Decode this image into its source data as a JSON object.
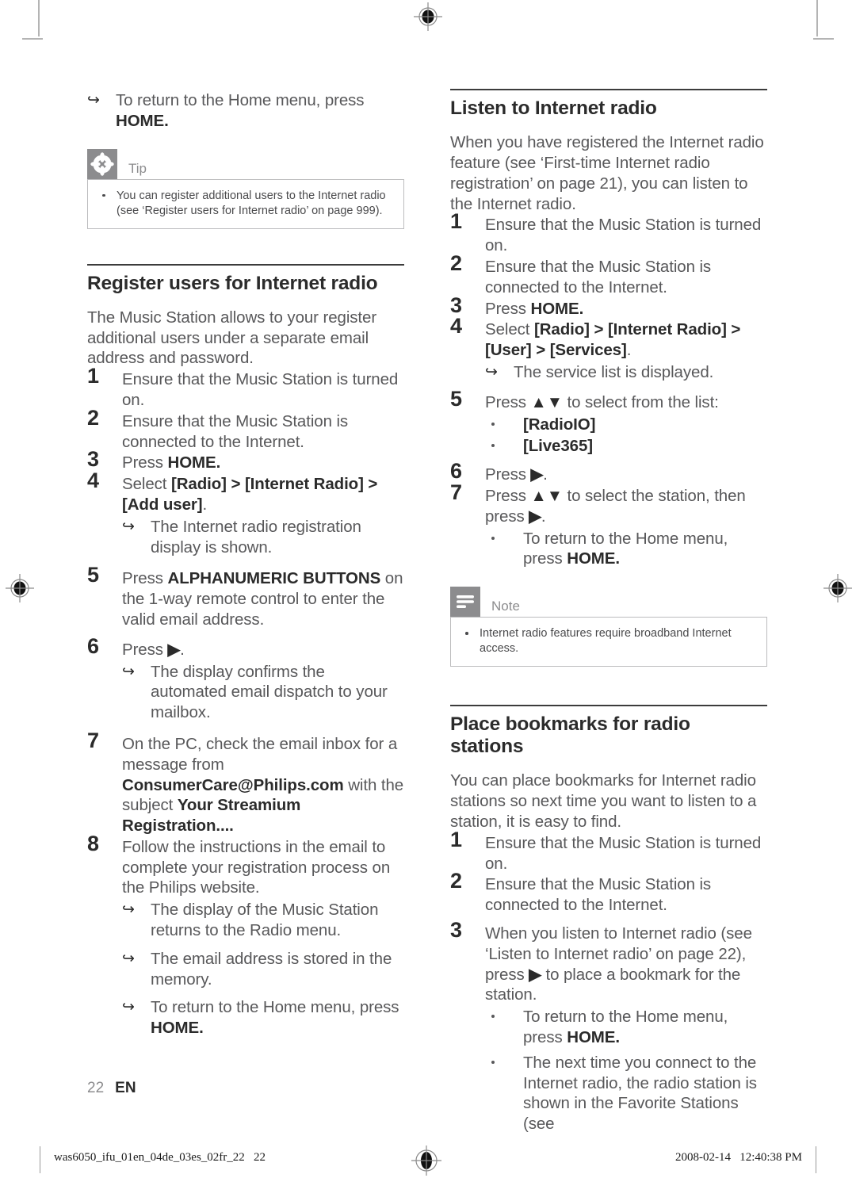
{
  "document": {
    "folio_number": "22",
    "folio_language": "EN"
  },
  "left_column": {
    "lead_arrow": {
      "glyph": "↪",
      "text_plain": "To return to the Home menu, press ",
      "text_bold": "HOME."
    },
    "tip_callout": {
      "icon": "asterisk-burst-icon",
      "label": "Tip",
      "lines": [
        "You can register additional users to the Internet radio (see ‘Register users for Internet radio’ on page 999)."
      ]
    },
    "section": {
      "title": "Register users for Internet radio",
      "intro": "The Music Station allows to your register additional users under a separate email address and password.",
      "steps": [
        {
          "num": "1",
          "text": "Ensure that the Music Station is turned on."
        },
        {
          "num": "2",
          "text": "Ensure that the Music Station is connected to the Internet."
        },
        {
          "num": "3",
          "text_plain": "Press ",
          "text_bold": "HOME."
        },
        {
          "num": "4",
          "text_plain": "Select ",
          "text_bold": "[Radio] > [Internet Radio] > [Add user]",
          "text_tail": ".",
          "arrows": [
            "The Internet radio registration display is shown."
          ]
        },
        {
          "num": "5",
          "text_plain": "Press ",
          "text_bold": "ALPHANUMERIC BUTTONS",
          "text_tail": " on the 1-way remote control to enter the valid email address."
        },
        {
          "num": "6",
          "text_plain": "Press ",
          "text_bold": "▶",
          "text_tail": ".",
          "arrows": [
            "The display confirms the automated email dispatch to your mailbox."
          ]
        },
        {
          "num": "7",
          "text_plain": "On the PC, check the email inbox for a message from ",
          "text_bold": "ConsumerCare@Philips.com",
          "text_mid": " with the subject ",
          "text_bold2": "Your Streamium Registration....",
          "text_tail": ""
        },
        {
          "num": "8",
          "text": "Follow the instructions in the email to complete your registration process on the Philips website.",
          "arrows": [
            "The display of the Music Station returns to the Radio menu.",
            "The email address is stored in the memory."
          ],
          "arrow_last_plain": "To return to the Home menu, press ",
          "arrow_last_bold": "HOME."
        }
      ]
    }
  },
  "right_column": {
    "listen_section": {
      "title": "Listen to Internet radio",
      "intro": "When you have registered the Internet radio feature (see ‘First-time Internet radio registration’ on page 21), you can listen to the Internet radio.",
      "steps": [
        {
          "num": "1",
          "text": "Ensure that the Music Station is turned on."
        },
        {
          "num": "2",
          "text": "Ensure that the Music Station is connected to the Internet."
        },
        {
          "num": "3",
          "text_plain": "Press ",
          "text_bold": "HOME."
        },
        {
          "num": "4",
          "text_plain": "Select ",
          "text_bold": "[Radio] > [Internet Radio] > [User] > [Services]",
          "text_tail": ".",
          "arrows": [
            "The service list is displayed."
          ]
        },
        {
          "num": "5",
          "text_plain": "Press ",
          "text_bold": "▲▼",
          "text_tail": " to select from the list:",
          "bullets": [
            "[RadioIO]",
            "[Live365]"
          ]
        },
        {
          "num": "6",
          "text_plain": "Press ",
          "text_bold": "▶",
          "text_tail": "."
        },
        {
          "num": "7",
          "text_plain": "Press ",
          "text_bold": "▲▼",
          "text_tail": " to select the station, then press ",
          "text_bold2": "▶",
          "text_tail2": ".",
          "bullets_plain": "To return to the Home menu, press ",
          "bullets_bold": "HOME."
        }
      ]
    },
    "note_callout": {
      "icon": "note-lines-icon",
      "label": "Note",
      "lines": [
        "Internet radio features require broadband Internet access."
      ]
    },
    "bookmarks_section": {
      "title": "Place bookmarks for radio stations",
      "intro": "You can place bookmarks for Internet radio stations so next time you want to listen to a station, it is easy to find.",
      "steps": [
        {
          "num": "1",
          "text": "Ensure that the Music Station is turned on."
        },
        {
          "num": "2",
          "text": "Ensure that the Music Station is connected to the Internet."
        },
        {
          "num": "3",
          "text_plain": "When you listen to Internet radio (see ‘Listen to Internet radio’ on page 22), press ",
          "text_bold": "▶",
          "text_tail": " to place a bookmark for the station.",
          "bullet_1_plain": "To return to the Home menu, press ",
          "bullet_1_bold": "HOME.",
          "bullet_2": "The next time you connect to the Internet radio, the radio station is shown in the Favorite Stations (see"
        }
      ]
    }
  },
  "slug": {
    "file": "was6050_ifu_01en_04de_03es_02fr_22   22",
    "timestamp": "2008-02-14   12:40:38 PM",
    "registration_icon": "registration-target-icon"
  },
  "colors": {
    "body_text": "#58585a",
    "heading": "#2b2b2b",
    "callout_gray": "#8c8c8e",
    "callout_border": "#bcbcbe",
    "rule": "#3c3c3c"
  }
}
